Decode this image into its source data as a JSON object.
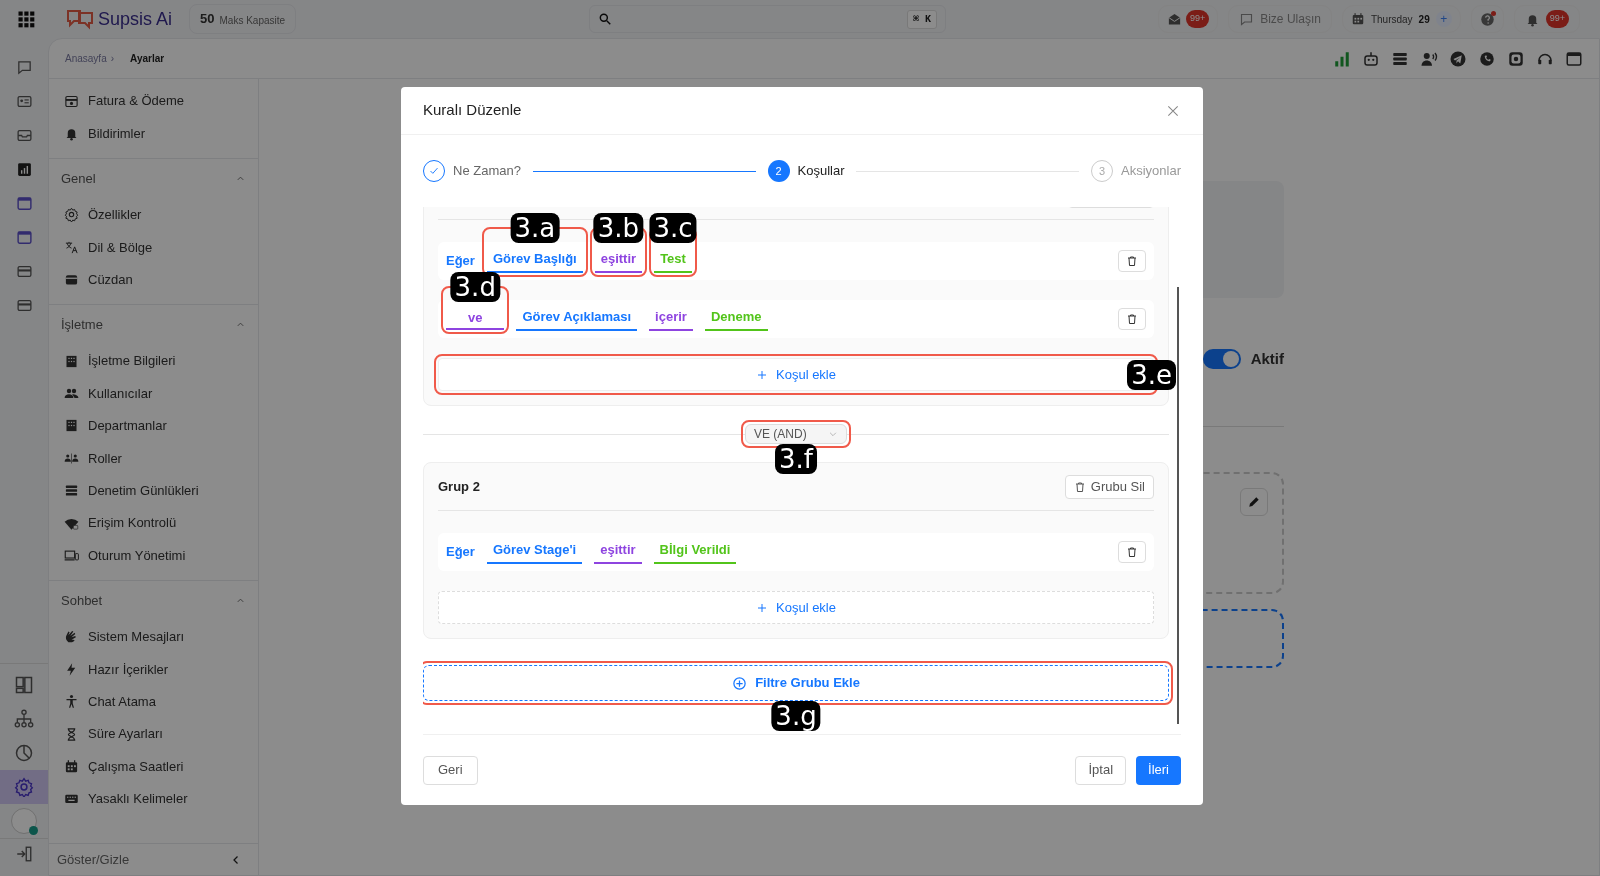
{
  "topbar": {
    "logo": "Supsis Ai",
    "capacity": {
      "value": "50",
      "label": "Maks Kapasite"
    },
    "search": {
      "shortcut": "⌘ K"
    },
    "mail_badge": "99+",
    "contact": "Bize Ulaşın",
    "date": {
      "day": "Thursday",
      "number": "29",
      "add": "+"
    },
    "help_dot": true,
    "notifications_badge": "99+"
  },
  "breadcrumb": {
    "items": [
      "Anasayfa",
      "Ayarlar"
    ],
    "separator": "›"
  },
  "rail": [
    {
      "selected": false
    },
    {
      "selected": false
    },
    {
      "selected": false
    },
    {
      "selected": false
    },
    {
      "selected": false
    },
    {
      "selected": false
    },
    {
      "selected": false
    },
    {
      "selected": false
    },
    {
      "selected": false
    },
    {
      "selected": false
    },
    {
      "selected": false
    },
    {
      "selected": true
    }
  ],
  "account": {
    "online": true
  },
  "sidebar": {
    "sections": [
      {
        "items": [
          "Fatura & Ödeme",
          "Bildirimler"
        ]
      },
      {
        "title": "Genel",
        "expanded": true,
        "items": [
          "Özellikler",
          "Dil & Bölge",
          "Cüzdan"
        ]
      },
      {
        "title": "İşletme",
        "expanded": true,
        "items": [
          "İşletme Bilgileri",
          "Kullanıcılar",
          "Departmanlar",
          "Roller",
          "Denetim Günlükleri",
          "Erişim Kontrolü",
          "Oturum Yönetimi"
        ]
      },
      {
        "title": "Sohbet",
        "expanded": true,
        "items": [
          "Sistem Mesajları",
          "Hazır İçerikler",
          "Chat Atama",
          "Süre Ayarları",
          "Çalışma Saatleri",
          "Yasaklı Kelimeler"
        ]
      }
    ],
    "footer": "Göster/Gizle"
  },
  "page": {
    "status": {
      "label": "Aktif",
      "on": true
    }
  },
  "modal": {
    "title": "Kuralı Düzenle",
    "steps": [
      {
        "label": "Ne Zaman?",
        "completed": true,
        "selected": false
      },
      {
        "number": "2",
        "label": "Koşullar",
        "completed": false,
        "selected": true
      },
      {
        "number": "3",
        "label": "Aksiyonlar",
        "completed": false,
        "selected": false
      }
    ],
    "groups": [
      {
        "conditions": [
          {
            "connector": {
              "text": "Eğer",
              "kind": "label"
            },
            "field": {
              "text": "Görev Başlığı",
              "annotation": "3.a"
            },
            "operator": {
              "text": "eşittir",
              "annotation": "3.b"
            },
            "value": {
              "text": "Test",
              "annotation": "3.c"
            }
          },
          {
            "connector": {
              "text": "ve",
              "kind": "select",
              "annotation": "3.d"
            },
            "field": {
              "text": "Görev Açıklaması"
            },
            "operator": {
              "text": "içerir"
            },
            "value": {
              "text": "Deneme"
            }
          }
        ],
        "add_condition": {
          "label": "Koşul ekle",
          "annotation": "3.e"
        }
      },
      {
        "title": "Grup 2",
        "delete": "Grubu Sil",
        "conditions": [
          {
            "connector": {
              "text": "Eğer",
              "kind": "label"
            },
            "field": {
              "text": "Görev Stage'i"
            },
            "operator": {
              "text": "eşittir"
            },
            "value": {
              "text": "Bİlgi Verildi"
            }
          }
        ],
        "add_condition": {
          "label": "Koşul ekle"
        }
      }
    ],
    "group_join": {
      "value": "VE (AND)",
      "annotation": "3.f"
    },
    "add_group": {
      "label": "Filtre Grubu Ekle",
      "annotation": "3.g"
    },
    "footer": {
      "back": "Geri",
      "cancel": "İptal",
      "next": "İleri"
    }
  }
}
